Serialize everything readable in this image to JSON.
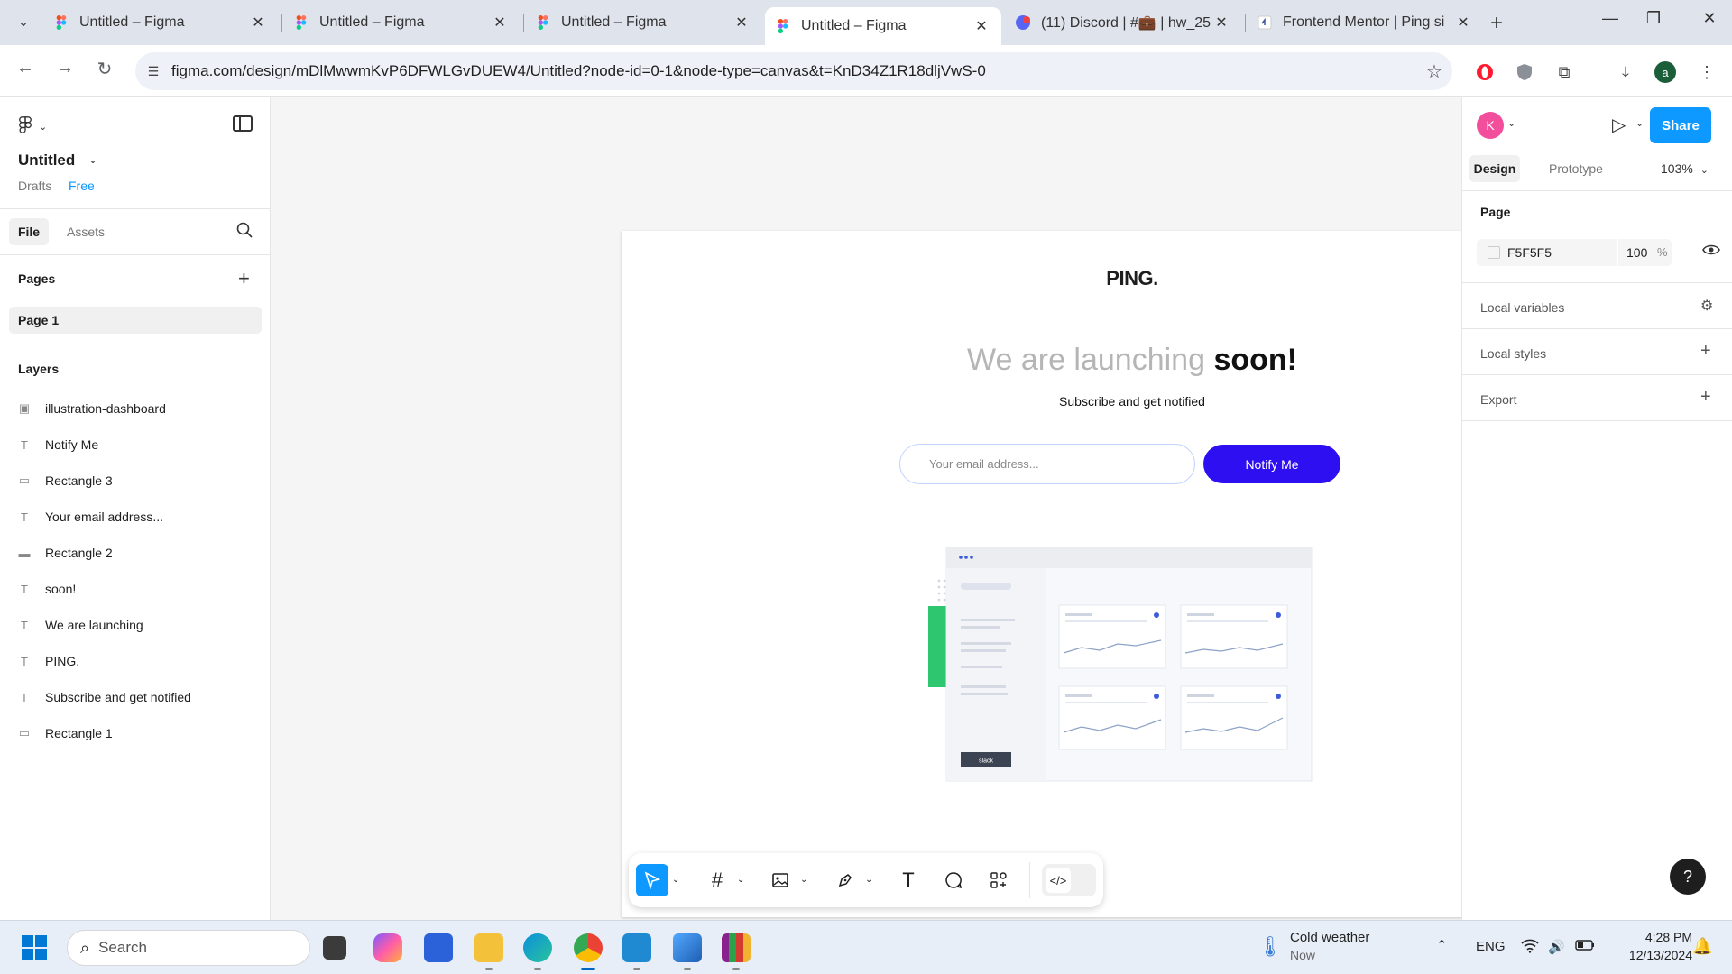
{
  "browser": {
    "tabs": [
      {
        "title": "Untitled – Figma",
        "icon": "figma-icon",
        "active": false
      },
      {
        "title": "Untitled – Figma",
        "icon": "figma-icon",
        "active": false
      },
      {
        "title": "Untitled – Figma",
        "icon": "figma-icon",
        "active": false
      },
      {
        "title": "Untitled – Figma",
        "icon": "figma-icon",
        "active": true
      },
      {
        "title": "(11) Discord | #💼 | hw_25",
        "icon": "discord-icon",
        "active": false
      },
      {
        "title": "Frontend Mentor | Ping si",
        "icon": "frontend-mentor-icon",
        "active": false
      }
    ],
    "url": "figma.com/design/mDlMwwmKvP6DFWLGvDUEW4/Untitled?node-id=0-1&node-type=canvas&t=KnD34Z1R18dljVwS-0",
    "profile_initial": "a"
  },
  "left_panel": {
    "file_title": "Untitled",
    "drafts_label": "Drafts",
    "plan_label": "Free",
    "tab_file": "File",
    "tab_assets": "Assets",
    "pages_heading": "Pages",
    "pages": [
      "Page 1"
    ],
    "layers_heading": "Layers",
    "layers": [
      {
        "name": "illustration-dashboard",
        "icon": "image-icon"
      },
      {
        "name": "Notify Me",
        "icon": "text-icon"
      },
      {
        "name": "Rectangle 3",
        "icon": "rectangle-icon"
      },
      {
        "name": "Your email address...",
        "icon": "text-icon"
      },
      {
        "name": "Rectangle 2",
        "icon": "rectangle-icon"
      },
      {
        "name": "soon!",
        "icon": "text-icon"
      },
      {
        "name": "We are launching",
        "icon": "text-icon"
      },
      {
        "name": "PING.",
        "icon": "text-icon"
      },
      {
        "name": "Subscribe and get notified",
        "icon": "text-icon"
      },
      {
        "name": "Rectangle 1",
        "icon": "rectangle-icon"
      }
    ]
  },
  "canvas": {
    "background": "#F5F5F5",
    "frame": {
      "logo": "PING.",
      "headline_light": "We are launching",
      "headline_bold": "soon!",
      "subtitle": "Subscribe and get notified",
      "email_placeholder": "Your email address...",
      "cta_label": "Notify Me",
      "cta_color": "#2D0FF2",
      "illustration_badge": "slack"
    }
  },
  "right_panel": {
    "avatar_initial": "K",
    "share_label": "Share",
    "tab_design": "Design",
    "tab_prototype": "Prototype",
    "zoom": "103%",
    "page_heading": "Page",
    "page_color_hex": "F5F5F5",
    "page_opacity": "100",
    "percent_sign": "%",
    "sections": [
      "Local variables",
      "Local styles",
      "Export"
    ],
    "help_label": "?"
  },
  "taskbar": {
    "search_placeholder": "Search",
    "weather_title": "Cold weather",
    "weather_sub": "Now",
    "language": "ENG",
    "time": "4:28 PM",
    "date": "12/13/2024"
  }
}
